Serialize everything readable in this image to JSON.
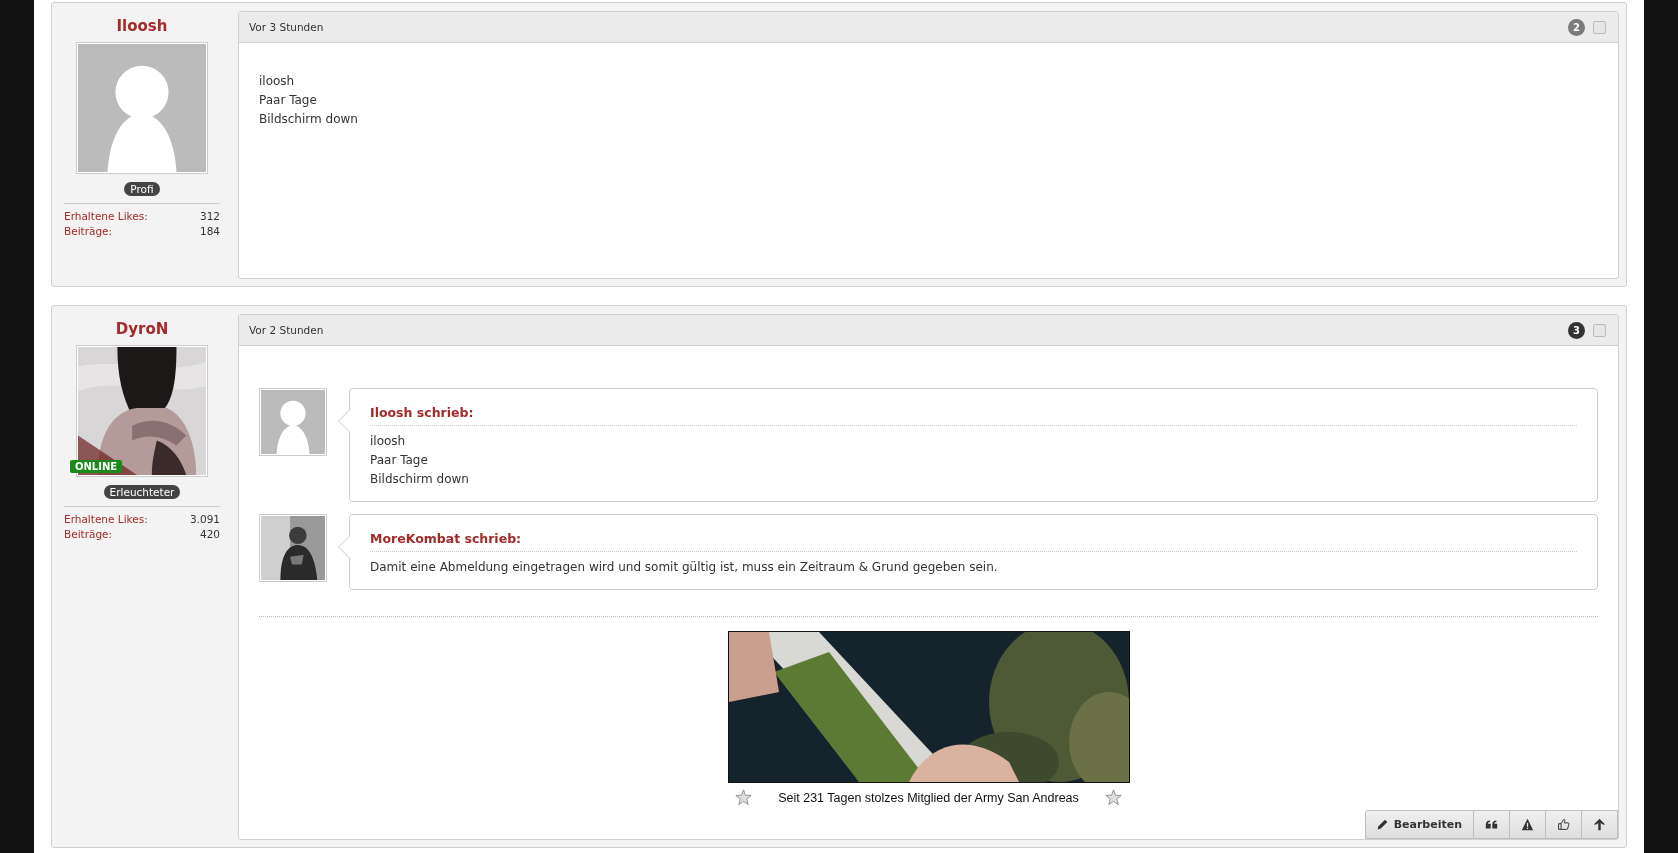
{
  "posts": [
    {
      "author": "Iloosh",
      "avatar": {
        "kind": "placeholder"
      },
      "online": false,
      "rank": "Profi",
      "stats": [
        {
          "label": "Erhaltene Likes:",
          "value": "312"
        },
        {
          "label": "Beiträge:",
          "value": "184"
        }
      ],
      "time": "Vor 3 Stunden",
      "number": "2",
      "color": "#7a7a7a",
      "checked": false,
      "message": [
        "iloosh",
        "Paar Tage",
        "Bildschirm down"
      ]
    },
    {
      "author": "DyroN",
      "avatar": {
        "kind": "picture"
      },
      "online": true,
      "online_label": "ONLINE",
      "rank": "Erleuchteter",
      "stats": [
        {
          "label": "Erhaltene Likes:",
          "value": "3.091"
        },
        {
          "label": "Beiträge:",
          "value": "420"
        }
      ],
      "time": "Vor 2 Stunden",
      "number": "3",
      "color": "#333333",
      "checked": false,
      "quotes": [
        {
          "author": "Iloosh schrieb:",
          "avatar": {
            "kind": "placeholder"
          },
          "lines": [
            "iloosh",
            "Paar Tage",
            "Bildschirm down"
          ]
        },
        {
          "author": "MoreKombat schrieb:",
          "avatar": {
            "kind": "picture"
          },
          "lines": [
            "Damit eine Abmeldung eingetragen wird und somit gültig ist, muss ein Zeitraum & Grund gegeben sein."
          ]
        }
      ],
      "signature": {
        "banner": {
          "kind": "picture"
        },
        "caption": "Seit 231 Tagen stolzes Mitglied der Army San Andreas"
      },
      "buttons": [
        {
          "kind": "edit",
          "label": "Bearbeiten"
        },
        {
          "kind": "quote"
        },
        {
          "kind": "report"
        },
        {
          "kind": "like"
        },
        {
          "kind": "top"
        }
      ]
    }
  ]
}
